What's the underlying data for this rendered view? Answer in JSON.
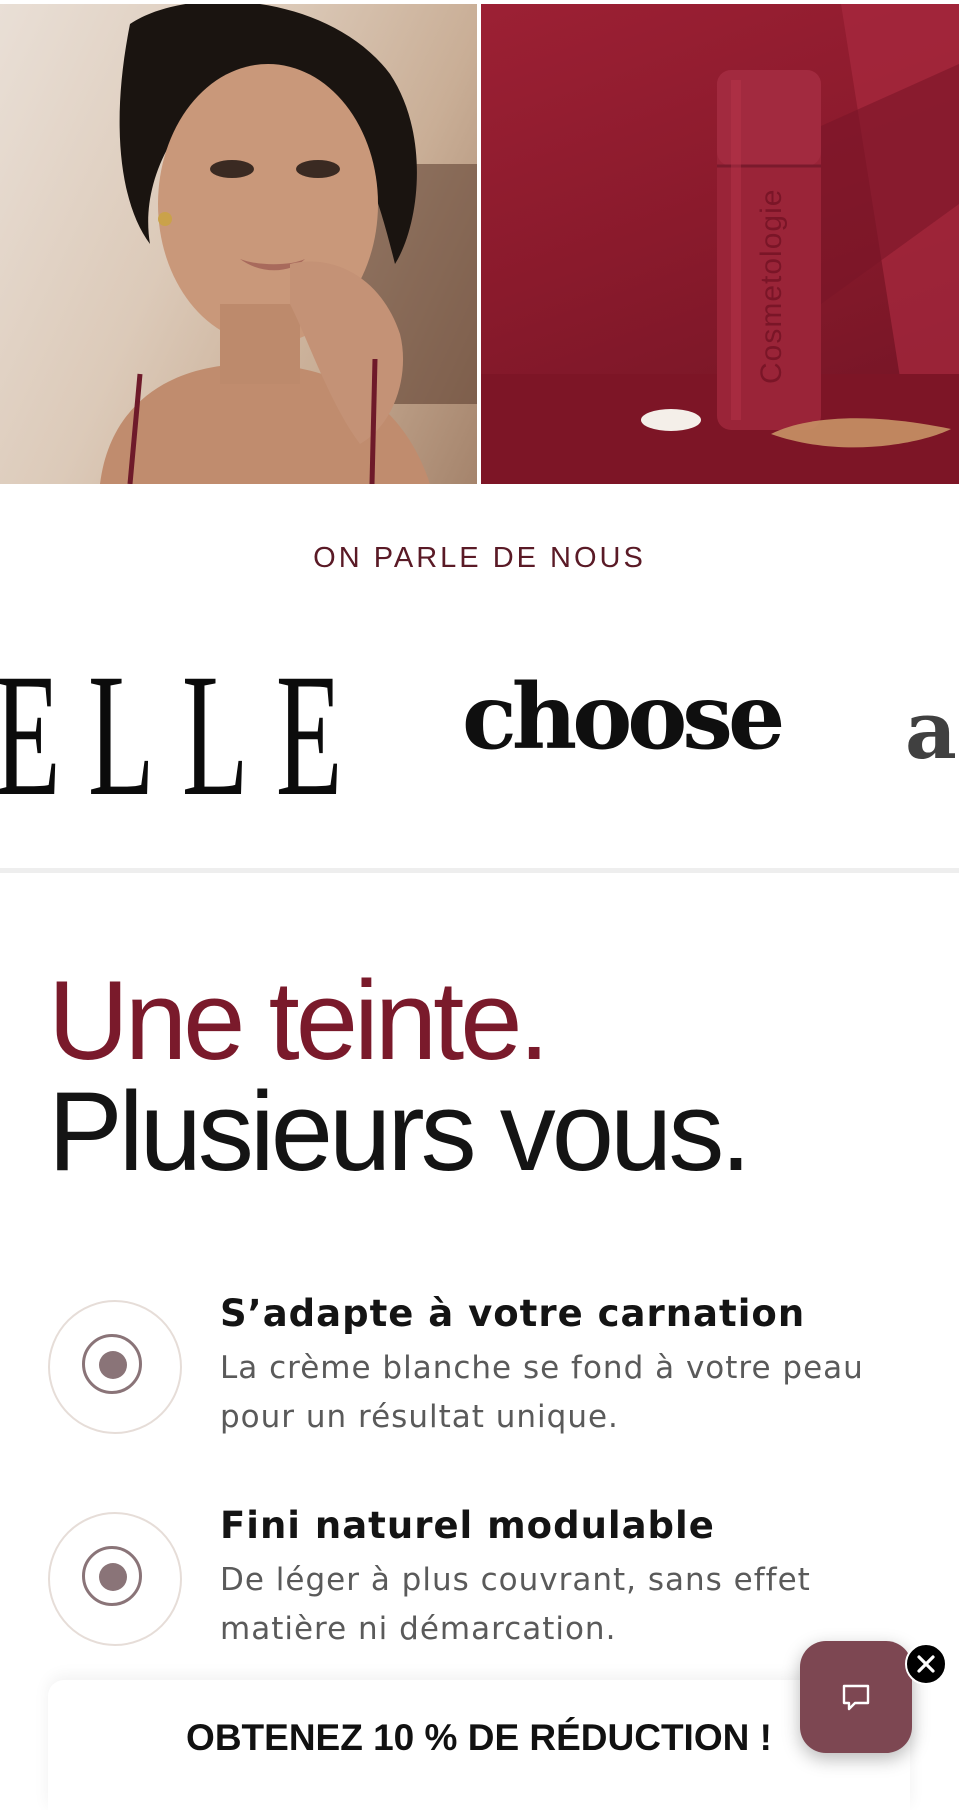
{
  "press": {
    "label": "ON PARLE DE NOUS",
    "logos": [
      "ELLE",
      "choose",
      "a"
    ]
  },
  "headline": {
    "line1": "Une teinte.",
    "line2": "Plusieurs vous."
  },
  "features": [
    {
      "title": "S’adapte à votre carnation",
      "description": "La crème blanche se fond à votre peau pour un résultat unique."
    },
    {
      "title": "Fini naturel modulable",
      "description": "De léger à plus couvrant, sans effet matière ni démarcation."
    }
  ],
  "product": {
    "brand_text": "Cosmetologie"
  },
  "promo": {
    "text": "OBTENEZ 10 % DE RÉDUCTION !"
  },
  "icons": {
    "chat": "chat-bubble-icon",
    "close": "close-icon"
  },
  "colors": {
    "accent": "#7a1a2b",
    "text": "#141414",
    "muted": "#5a5a5a",
    "chat_button": "#7d4752"
  }
}
